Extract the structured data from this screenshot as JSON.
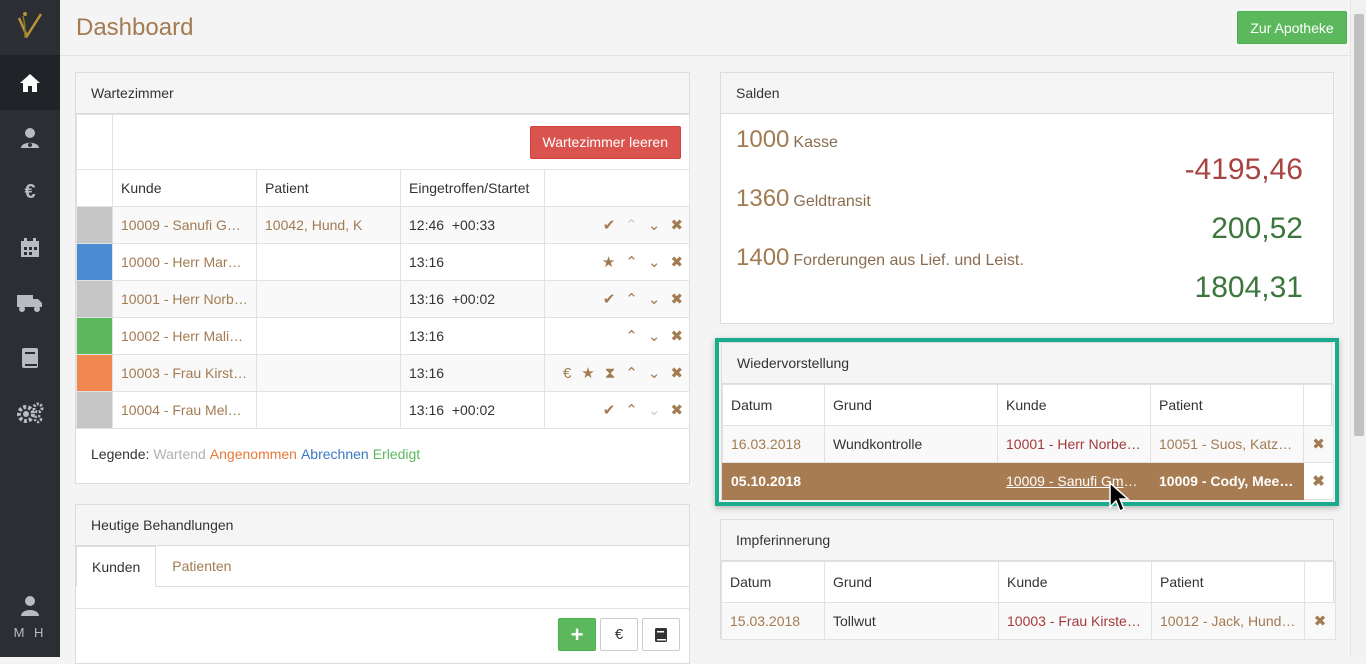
{
  "sidebar": {
    "items": [
      "home",
      "patients",
      "finance",
      "calendar",
      "delivery",
      "book",
      "settings"
    ],
    "user_initials": "M H"
  },
  "header": {
    "title": "Dashboard",
    "pharmacy_button": "Zur Apotheke"
  },
  "wartezimmer": {
    "title": "Wartezimmer",
    "clear_button": "Wartezimmer leeren",
    "columns": [
      "Kunde",
      "Patient",
      "Eingetroffen/Startet"
    ],
    "rows": [
      {
        "color": "#c6c6c6",
        "kunde": "10009 - Sanufi Gm…",
        "patient": "10042, Hund, K",
        "time": "12:46",
        "delta": "+00:33"
      },
      {
        "color": "#4a8bd4",
        "kunde": "10000 - Herr Mark…",
        "patient": "",
        "time": "13:16",
        "delta": ""
      },
      {
        "color": "#c6c6c6",
        "kunde": "10001 - Herr Norb…",
        "patient": "",
        "time": "13:16",
        "delta": "+00:02"
      },
      {
        "color": "#5cb85c",
        "kunde": "10002 - Herr Malik …",
        "patient": "",
        "time": "13:16",
        "delta": ""
      },
      {
        "color": "#f0874f",
        "kunde": "10003 - Frau Kirste…",
        "patient": "",
        "time": "13:16",
        "delta": ""
      },
      {
        "color": "#c6c6c6",
        "kunde": "10004 - Frau Mela…",
        "patient": "",
        "time": "13:16",
        "delta": "+00:02"
      }
    ],
    "legend_label": "Legende:",
    "legend": [
      {
        "text": "Wartend",
        "color": "#b0b0b0"
      },
      {
        "text": "Angenommen",
        "color": "#e8793a"
      },
      {
        "text": "Abrechnen",
        "color": "#3a78c2"
      },
      {
        "text": "Erledigt",
        "color": "#5cb85c"
      }
    ]
  },
  "behandlungen": {
    "title": "Heutige Behandlungen",
    "tabs": [
      "Kunden",
      "Patienten"
    ]
  },
  "salden": {
    "title": "Salden",
    "accounts": [
      {
        "num": "1000",
        "name": "Kasse",
        "value": "-4195,46",
        "sign": "neg"
      },
      {
        "num": "1360",
        "name": "Geldtransit",
        "value": "200,52",
        "sign": "pos"
      },
      {
        "num": "1400",
        "name": "Forderungen aus Lief. und Leist.",
        "value": "1804,31",
        "sign": "pos"
      }
    ]
  },
  "wiedervorstellung": {
    "title": "Wiedervorstellung",
    "columns": [
      "Datum",
      "Grund",
      "Kunde",
      "Patient"
    ],
    "rows": [
      {
        "datum": "16.03.2018",
        "grund": "Wundkontrolle",
        "kunde": "10001 - Herr Norber…",
        "patient": "10051 - Suos, Katze,…"
      },
      {
        "datum": "05.10.2018",
        "grund": "",
        "kunde": "10009 - Sanufi Gmb…",
        "patient": "10009 - Cody, Meers…"
      }
    ]
  },
  "impferinnerung": {
    "title": "Impferinnerung",
    "columns": [
      "Datum",
      "Grund",
      "Kunde",
      "Patient"
    ],
    "rows": [
      {
        "datum": "15.03.2018",
        "grund": "Tollwut",
        "kunde": "10003 - Frau Kirsten…",
        "patient": "10012 - Jack, Hund, …"
      }
    ]
  },
  "colors": {
    "accent": "#a27b52",
    "highlight_frame": "#1aaa8c",
    "sidebar": "#2b2f33"
  }
}
